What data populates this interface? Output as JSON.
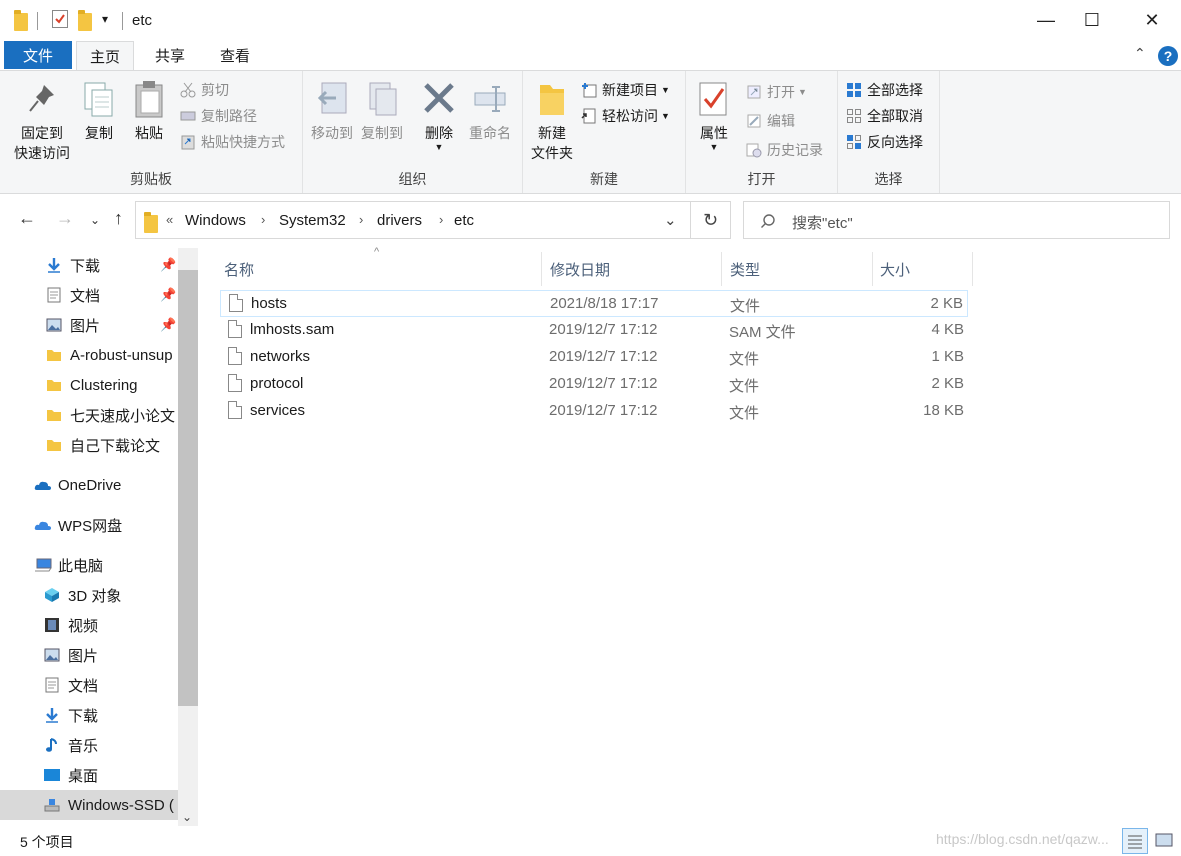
{
  "window": {
    "title": "etc",
    "qat_dropdown": "▾",
    "minimize": "—",
    "maximize": "☐",
    "close": "✕"
  },
  "menu": {
    "file": "文件",
    "tabs": [
      "主页",
      "共享",
      "查看"
    ],
    "active_tab": "主页",
    "help": "?",
    "collapse": "⌃"
  },
  "ribbon": {
    "clipboard": {
      "label": "剪贴板",
      "pin_line1": "固定到",
      "pin_line2": "快速访问",
      "copy": "复制",
      "paste": "粘贴",
      "cut": "剪切",
      "copy_path": "复制路径",
      "paste_shortcut": "粘贴快捷方式"
    },
    "organize": {
      "label": "组织",
      "move_to": "移动到",
      "copy_to": "复制到",
      "delete": "删除",
      "rename": "重命名"
    },
    "new": {
      "label": "新建",
      "new_folder_line1": "新建",
      "new_folder_line2": "文件夹",
      "new_item": "新建项目",
      "easy_access": "轻松访问"
    },
    "open": {
      "label": "打开",
      "properties": "属性",
      "open": "打开",
      "edit": "编辑",
      "history": "历史记录"
    },
    "select": {
      "label": "选择",
      "select_all": "全部选择",
      "select_none": "全部取消",
      "invert": "反向选择"
    }
  },
  "address": {
    "overflow": "«",
    "crumbs": [
      "Windows",
      "System32",
      "drivers",
      "etc"
    ],
    "search_placeholder": "搜索\"etc\""
  },
  "sidebar": {
    "items": [
      {
        "label": "下载",
        "icon": "download-arrow-icon",
        "pinned": true
      },
      {
        "label": "文档",
        "icon": "document-icon",
        "pinned": true
      },
      {
        "label": "图片",
        "icon": "picture-icon",
        "pinned": true
      },
      {
        "label": "A-robust-unsup",
        "icon": "folder-icon",
        "pinned": false
      },
      {
        "label": "Clustering",
        "icon": "folder-icon",
        "pinned": false
      },
      {
        "label": "七天速成小论文",
        "icon": "folder-icon",
        "pinned": false
      },
      {
        "label": "自己下载论文",
        "icon": "folder-icon",
        "pinned": false
      },
      {
        "label": "OneDrive",
        "icon": "cloud-icon",
        "pinned": false
      },
      {
        "label": "WPS网盘",
        "icon": "cloud-icon",
        "pinned": false
      },
      {
        "label": "此电脑",
        "icon": "computer-icon",
        "pinned": false
      },
      {
        "label": "3D 对象",
        "icon": "cube-icon",
        "pinned": false
      },
      {
        "label": "视频",
        "icon": "video-icon",
        "pinned": false
      },
      {
        "label": "图片",
        "icon": "picture-icon",
        "pinned": false
      },
      {
        "label": "文档",
        "icon": "document-icon",
        "pinned": false
      },
      {
        "label": "下载",
        "icon": "download-arrow-icon",
        "pinned": false
      },
      {
        "label": "音乐",
        "icon": "music-note-icon",
        "pinned": false
      },
      {
        "label": "桌面",
        "icon": "desktop-icon",
        "pinned": false
      },
      {
        "label": "Windows-SSD (",
        "icon": "drive-icon",
        "pinned": false
      }
    ]
  },
  "columns": [
    "名称",
    "修改日期",
    "类型",
    "大小"
  ],
  "files": [
    {
      "name": "hosts",
      "modified": "2021/8/18 17:17",
      "type": "文件",
      "size": "2 KB"
    },
    {
      "name": "lmhosts.sam",
      "modified": "2019/12/7 17:12",
      "type": "SAM 文件",
      "size": "4 KB"
    },
    {
      "name": "networks",
      "modified": "2019/12/7 17:12",
      "type": "文件",
      "size": "1 KB"
    },
    {
      "name": "protocol",
      "modified": "2019/12/7 17:12",
      "type": "文件",
      "size": "2 KB"
    },
    {
      "name": "services",
      "modified": "2019/12/7 17:12",
      "type": "文件",
      "size": "18 KB"
    }
  ],
  "status": {
    "item_count": "5 个项目",
    "watermark": "https://blog.csdn.net/qazw..."
  },
  "colors": {
    "accent": "#1a6fc0",
    "ribbon_bg": "#f5f6f7",
    "folder": "#f4c542",
    "selected_bg": "#d9d9d9",
    "hover_border": "#cce8ff"
  }
}
